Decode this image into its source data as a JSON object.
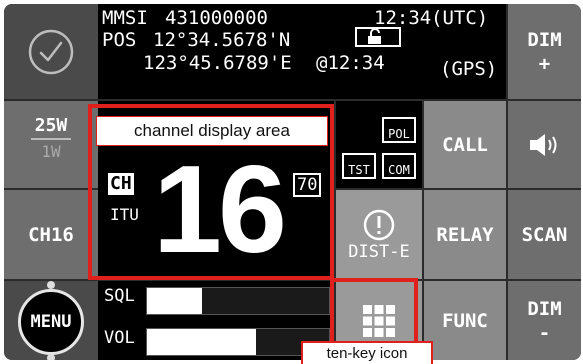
{
  "status": {
    "mmsi_label": "MMSI",
    "mmsi_value": "431000000",
    "time": "12:34",
    "time_zone": "(UTC)",
    "pos_label": "POS",
    "lat": "12°34.5678'N",
    "lon": "123°45.6789'E",
    "fix_time": "@12:34",
    "source": "(GPS)"
  },
  "power": {
    "high": "25W",
    "low": "1W"
  },
  "buttons": {
    "dim_plus": {
      "line1": "DIM",
      "line2": "+"
    },
    "call": "CALL",
    "ch16": "CH16",
    "relay": "RELAY",
    "scan": "SCAN",
    "menu": "MENU",
    "func": "FUNC",
    "dist_e": "DIST-E",
    "dim_minus": {
      "line1": "DIM",
      "line2": "-"
    }
  },
  "channel": {
    "number": "16",
    "prefix": "CH",
    "region": "ITU",
    "secondary": "70"
  },
  "status_icons": {
    "pol": "POL",
    "tst": "TST",
    "com": "COM"
  },
  "levels": {
    "sql_label": "SQL",
    "sql_fraction": 0.3,
    "vol_label": "VOL",
    "vol_fraction": 0.6
  },
  "annotations": {
    "channel_area": "channel display area",
    "tenkey": "ten-key icon"
  },
  "colors": {
    "annotation": "#e0201c",
    "button": "#6e6e6e",
    "background": "#2b2b2b"
  }
}
